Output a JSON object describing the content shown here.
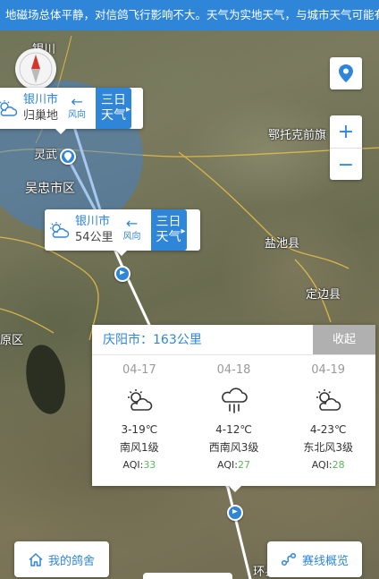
{
  "banner": {
    "text": "地磁场总体平静，对信鸽飞行影响不大。天气为实地天气，与城市天气可能有"
  },
  "map_labels": {
    "yinchuan_top": "银川",
    "lingwu": "灵武",
    "ecommerce": "吴忠市区",
    "eetuoke": "鄂托克前旗",
    "yanchi": "盐池县",
    "dingbian": "定边县",
    "huan_county": "环县",
    "left_edge": "原区"
  },
  "card_origin": {
    "city": "银川市",
    "sub": "归巢地",
    "wind_label": "风向",
    "three_day_line1": "三日",
    "three_day_line2": "天气"
  },
  "card_route": {
    "city": "银川市",
    "sub": "54公里",
    "wind_label": "风向",
    "three_day_line1": "三日",
    "three_day_line2": "天气"
  },
  "forecast": {
    "title": "庆阳市：163公里",
    "collapse_label": "收起",
    "days": [
      {
        "date": "04-17",
        "icon": "partly-cloudy-icon",
        "temp": "3-19℃",
        "wind": "南风1级",
        "aqi_label": "AQI:",
        "aqi": "33"
      },
      {
        "date": "04-18",
        "icon": "rain-icon",
        "temp": "4-12℃",
        "wind": "西南风3级",
        "aqi_label": "AQI:",
        "aqi": "27"
      },
      {
        "date": "04-19",
        "icon": "partly-cloudy-icon",
        "temp": "4-23℃",
        "wind": "东北风3级",
        "aqi_label": "AQI:",
        "aqi": "28"
      }
    ]
  },
  "buttons": {
    "my_loft": "我的鸽舍",
    "route_overview": "赛线概览"
  },
  "colors": {
    "accent": "#2f86d8",
    "aqi_good": "#5cb85c",
    "collapse_bg": "#b0b0b0"
  },
  "icons": {
    "compass": "compass-icon",
    "locate": "location-pin-icon",
    "zoom_in": "plus-icon",
    "zoom_out": "minus-icon",
    "home": "home-icon",
    "route": "route-icon",
    "wind_arrow": "arrow-left-icon",
    "chevron": "chevron-right-icon"
  }
}
